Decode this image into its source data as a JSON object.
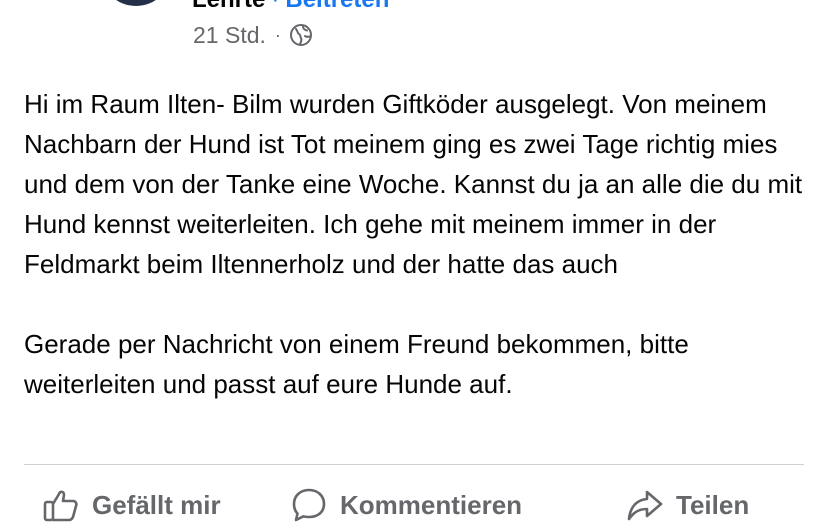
{
  "header": {
    "author": "Lehrte",
    "separator": "·",
    "join_label": "Beitreten"
  },
  "meta": {
    "time": "21 Std.",
    "dot": "·",
    "privacy_icon": "globe-icon"
  },
  "post": {
    "paragraphs": [
      "Hi im Raum Ilten- Bilm wurden Giftköder ausgelegt. Von meinem Nachbarn der Hund ist Tot meinem ging es zwei Tage richtig mies und dem von der Tanke eine Woche. Kannst du ja an alle die du mit Hund kennst weiterleiten. Ich gehe mit meinem immer in der Feldmarkt beim Iltennerholz und der hatte das auch",
      "Gerade per Nachricht von einem Freund bekommen, bitte weiterleiten und passt auf eure Hunde auf."
    ]
  },
  "actions": {
    "like": {
      "label": "Gefällt mir",
      "icon": "thumbs-up-icon"
    },
    "comment": {
      "label": "Kommentieren",
      "icon": "comment-bubble-icon"
    },
    "share": {
      "label": "Teilen",
      "icon": "share-arrow-icon"
    }
  },
  "colors": {
    "text": "#050505",
    "secondary": "#65676b",
    "link": "#1877f2",
    "divider": "#ced0d4"
  }
}
